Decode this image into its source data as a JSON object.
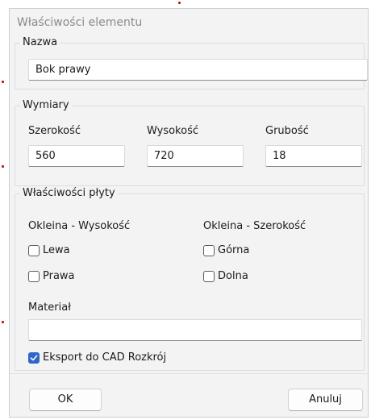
{
  "dialog": {
    "title": "Właściwości elementu"
  },
  "name_group": {
    "label": "Nazwa",
    "value": "Bok prawy"
  },
  "dimensions_group": {
    "label": "Wymiary",
    "width_label": "Szerokość",
    "width_value": "560",
    "height_label": "Wysokość",
    "height_value": "720",
    "thickness_label": "Grubość",
    "thickness_value": "18"
  },
  "board_group": {
    "label": "Właściwości płyty",
    "edge_height_label": "Okleina - Wysokość",
    "edge_width_label": "Okleina - Szerokość",
    "left_label": "Lewa",
    "left_checked": false,
    "right_label": "Prawa",
    "right_checked": false,
    "top_label": "Górna",
    "top_checked": false,
    "bottom_label": "Dolna",
    "bottom_checked": false,
    "material_label": "Materiał",
    "material_value": "",
    "export_label": "Eksport do CAD Rozkrój",
    "export_checked": true
  },
  "buttons": {
    "ok_label": "OK",
    "cancel_label": "Anuluj"
  },
  "colors": {
    "accent": "#2f66c9",
    "dialog_bg": "#f3f3f3"
  }
}
